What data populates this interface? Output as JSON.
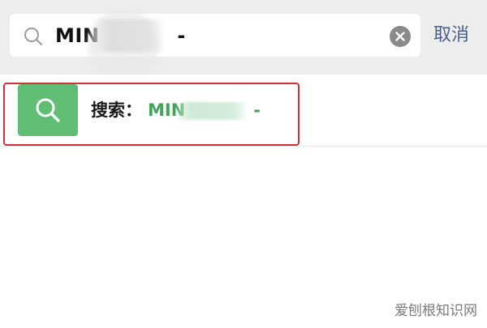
{
  "search_bar": {
    "query": "MIN",
    "query_suffix": "-",
    "cancel_label": "取消",
    "icon": "search-icon",
    "clear_icon": "clear-icon"
  },
  "result": {
    "label": "搜索：",
    "query": "MIN",
    "query_suffix": "-",
    "icon": "search-icon",
    "icon_bg_color": "#5fbe73",
    "query_color": "#3fa55a"
  },
  "highlight": {
    "color": "#d32f3b"
  },
  "watermark": {
    "text": "爱刨根知识网"
  }
}
